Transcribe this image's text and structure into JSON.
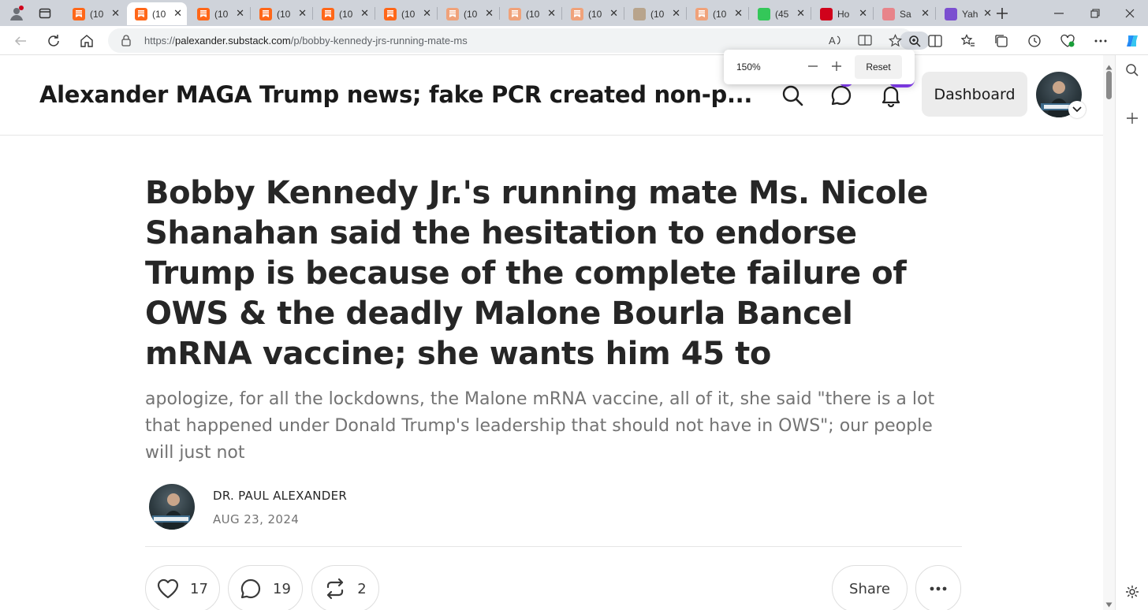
{
  "browser": {
    "tabs": [
      {
        "title": "(10",
        "favicon": "substack-icon",
        "color": "#ff6719",
        "active": false
      },
      {
        "title": "(10",
        "favicon": "substack-icon",
        "color": "#ff6719",
        "active": true
      },
      {
        "title": "(10",
        "favicon": "substack-icon",
        "color": "#ff6719",
        "active": false
      },
      {
        "title": "(10",
        "favicon": "substack-icon",
        "color": "#ff6719",
        "active": false
      },
      {
        "title": "(10",
        "favicon": "substack-icon",
        "color": "#ff6719",
        "active": false
      },
      {
        "title": "(10",
        "favicon": "substack-icon",
        "color": "#ff6719",
        "active": false
      },
      {
        "title": "(10",
        "favicon": "substack-icon",
        "color": "#f0a27a",
        "active": false
      },
      {
        "title": "(10",
        "favicon": "substack-icon",
        "color": "#f0a27a",
        "active": false
      },
      {
        "title": "(10",
        "favicon": "substack-icon",
        "color": "#f0a27a",
        "active": false
      },
      {
        "title": "(10",
        "favicon": "image-icon",
        "color": "#b8a48c",
        "active": false
      },
      {
        "title": "(10",
        "favicon": "substack-icon",
        "color": "#f0a27a",
        "active": false
      },
      {
        "title": "(45",
        "favicon": "g-icon",
        "color": "#34c759",
        "active": false
      },
      {
        "title": "Ho",
        "favicon": "red-icon",
        "color": "#d0021b",
        "active": false
      },
      {
        "title": "Sa",
        "favicon": "youtube-icon",
        "color": "#e8848a",
        "active": false
      },
      {
        "title": "Yah",
        "favicon": "yahoo-icon",
        "color": "#7b4fd0",
        "active": false
      }
    ],
    "url_prefix": "https://",
    "url_domain": "palexander.substack.com",
    "url_path": "/p/bobby-kennedy-jrs-running-mate-ms",
    "zoom": {
      "level": "150%",
      "reset_label": "Reset"
    }
  },
  "site": {
    "title": "Alexander MAGA Trump news; fake PCR created non-p...",
    "dashboard_label": "Dashboard"
  },
  "post": {
    "headline": "Bobby Kennedy Jr.'s running mate Ms. Nicole Shanahan said the hesitation to endorse Trump is because of the complete failure of OWS & the deadly Malone Bourla Bancel mRNA vaccine; she wants him 45 to",
    "subtitle": "apologize, for all the lockdowns, the Malone mRNA vaccine, all of it, she said \"there is a lot that happened under Donald Trump's leadership that should not have in OWS\"; our people will just not",
    "author": "DR. PAUL ALEXANDER",
    "date": "AUG 23, 2024",
    "likes": "17",
    "comments": "19",
    "restacks": "2",
    "share_label": "Share"
  }
}
